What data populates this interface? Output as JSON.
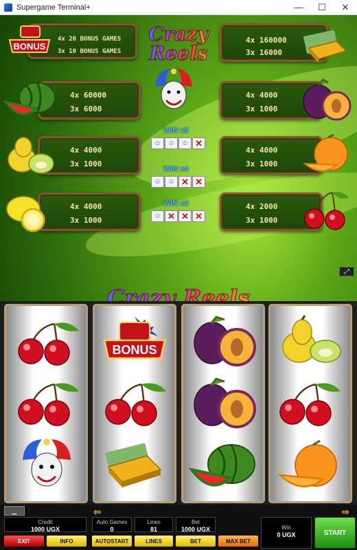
{
  "window": {
    "title": "Supergame Terminal+",
    "minimize": "—",
    "maximize": "☐",
    "close": "✕"
  },
  "logo_top": {
    "line1": "Crazy",
    "line2": "Reels"
  },
  "logo_main": "Crazy Reels",
  "paytable": {
    "bonus": {
      "badge": "BONUS",
      "row1": "4x 20 BONUS GAMES",
      "row2": "3x 10 BONUS GAMES"
    },
    "gold": {
      "row1": "4x 160000",
      "row2": "3x 16000"
    },
    "watermelon": {
      "row1": "4x 60000",
      "row2": "3x 6000"
    },
    "plum": {
      "row1": "4x 4000",
      "row2": "3x 1000"
    },
    "pear": {
      "row1": "4x 4000",
      "row2": "3x 1000"
    },
    "orange": {
      "row1": "4x 4000",
      "row2": "3x 1000"
    },
    "lemon": {
      "row1": "4x 4000",
      "row2": "3x 1000"
    },
    "cherry": {
      "row1": "4x 2000",
      "row2": "3x 1000"
    }
  },
  "joker_wins": [
    {
      "label": "WIN x8",
      "jokers": 3
    },
    {
      "label": "WIN x4",
      "jokers": 2
    },
    {
      "label": "WIN x2",
      "jokers": 1
    }
  ],
  "reels": [
    [
      "cherry",
      "cherry",
      "joker"
    ],
    [
      "bonus",
      "cherry",
      "gold"
    ],
    [
      "plum",
      "plum",
      "watermelon"
    ],
    [
      "pear",
      "cherry",
      "orange"
    ]
  ],
  "bottom": {
    "credit_label": "Credit",
    "credit_value": "1000 UGX",
    "auto_games_label": "Auto Games",
    "auto_games_value": "0",
    "lines_label": "Lines",
    "lines_value": "81",
    "bet_label": "Bet",
    "bet_value": "1000 UGX",
    "win_label": "Win",
    "win_value": "0 UGX",
    "exit": "EXIT",
    "info": "INFO",
    "autostart": "AUTOSTART",
    "lines_btn": "LINES",
    "bet_btn": "BET",
    "max_bet": "MAX BET",
    "start": "START"
  },
  "colors": {
    "panel_text": "#f4e6a8",
    "win_label": "#4fb6ff",
    "start": "#3cb82a"
  }
}
